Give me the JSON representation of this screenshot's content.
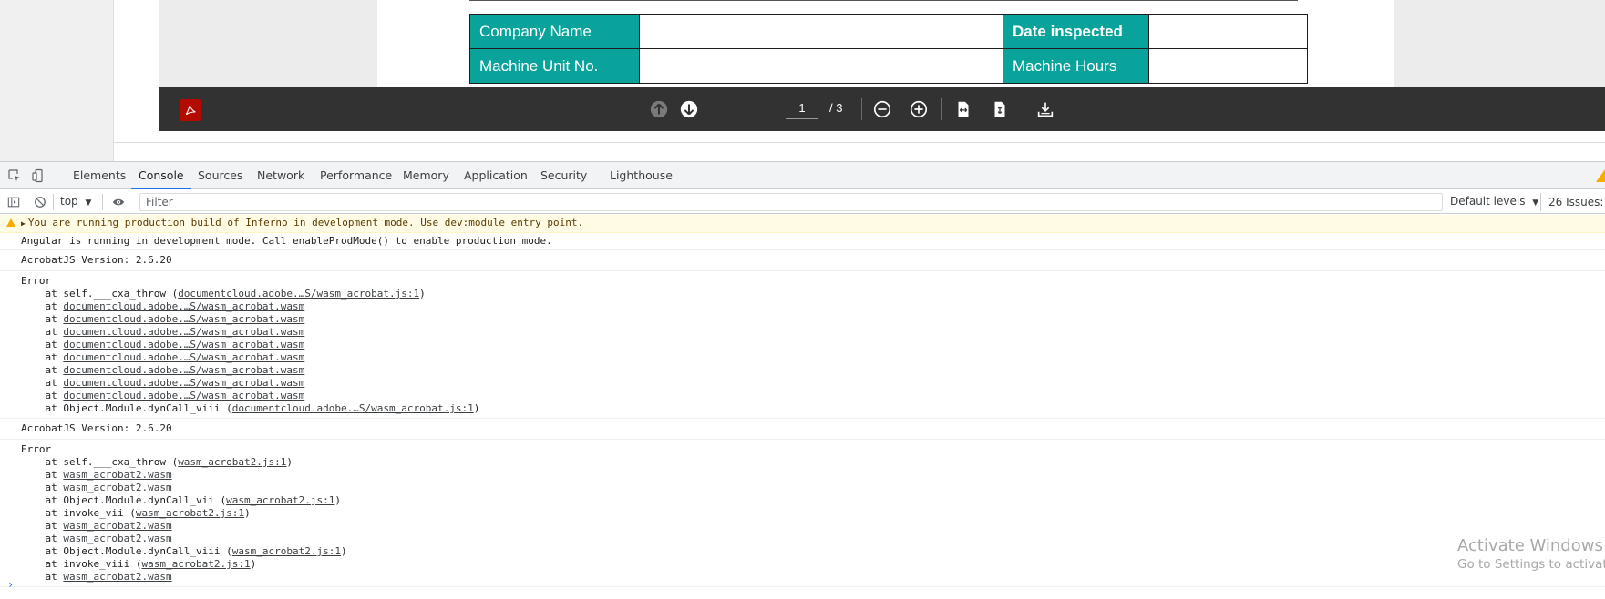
{
  "document": {
    "form_rows": [
      {
        "label_left": "Company Name",
        "label_right": "Date inspected"
      },
      {
        "label_left": "Machine Unit No.",
        "label_right": "Machine Hours"
      }
    ]
  },
  "pdf_toolbar": {
    "current_page": "1",
    "total_pages": "/ 3",
    "icons": [
      "acrobat-logo-icon",
      "previous-page-icon",
      "next-page-icon",
      "zoom-out-icon",
      "zoom-in-icon",
      "fit-width-icon",
      "fit-page-icon",
      "download-icon"
    ]
  },
  "devtools": {
    "tabs": [
      "Elements",
      "Console",
      "Sources",
      "Network",
      "Performance",
      "Memory",
      "Application",
      "Security",
      "Lighthouse"
    ],
    "active_tab": "Console",
    "context": "top",
    "filter_placeholder": "Filter",
    "levels": "Default levels",
    "issues": "26 Issues:"
  },
  "console": {
    "warning": "You are running production build of Inferno in development mode. Use dev:module entry point.",
    "angular": "Angular is running in development mode. Call enableProdMode() to enable production mode.",
    "acrobat_version_1": "AcrobatJS Version: 2.6.20",
    "error1_title": "Error",
    "error1_lines": [
      {
        "pre": "    at self.___cxa_throw (",
        "link": "documentcloud.adobe.…S/wasm_acrobat.js:1",
        "post": ")"
      },
      {
        "pre": "    at ",
        "link": "documentcloud.adobe.…S/wasm_acrobat.wasm",
        "post": ""
      },
      {
        "pre": "    at ",
        "link": "documentcloud.adobe.…S/wasm_acrobat.wasm",
        "post": ""
      },
      {
        "pre": "    at ",
        "link": "documentcloud.adobe.…S/wasm_acrobat.wasm",
        "post": ""
      },
      {
        "pre": "    at ",
        "link": "documentcloud.adobe.…S/wasm_acrobat.wasm",
        "post": ""
      },
      {
        "pre": "    at ",
        "link": "documentcloud.adobe.…S/wasm_acrobat.wasm",
        "post": ""
      },
      {
        "pre": "    at ",
        "link": "documentcloud.adobe.…S/wasm_acrobat.wasm",
        "post": ""
      },
      {
        "pre": "    at ",
        "link": "documentcloud.adobe.…S/wasm_acrobat.wasm",
        "post": ""
      },
      {
        "pre": "    at ",
        "link": "documentcloud.adobe.…S/wasm_acrobat.wasm",
        "post": ""
      },
      {
        "pre": "    at Object.Module.dynCall_viii (",
        "link": "documentcloud.adobe.…S/wasm_acrobat.js:1",
        "post": ")"
      }
    ],
    "acrobat_version_2": "AcrobatJS Version: 2.6.20",
    "error2_title": "Error",
    "error2_lines": [
      {
        "pre": "    at self.___cxa_throw (",
        "link": "wasm_acrobat2.js:1",
        "post": ")"
      },
      {
        "pre": "    at ",
        "link": "wasm_acrobat2.wasm",
        "post": ""
      },
      {
        "pre": "    at ",
        "link": "wasm_acrobat2.wasm",
        "post": ""
      },
      {
        "pre": "    at Object.Module.dynCall_vii (",
        "link": "wasm_acrobat2.js:1",
        "post": ")"
      },
      {
        "pre": "    at invoke_vii (",
        "link": "wasm_acrobat2.js:1",
        "post": ")"
      },
      {
        "pre": "    at ",
        "link": "wasm_acrobat2.wasm",
        "post": ""
      },
      {
        "pre": "    at ",
        "link": "wasm_acrobat2.wasm",
        "post": ""
      },
      {
        "pre": "    at Object.Module.dynCall_viii (",
        "link": "wasm_acrobat2.js:1",
        "post": ")"
      },
      {
        "pre": "    at invoke_viii (",
        "link": "wasm_acrobat2.js:1",
        "post": ")"
      },
      {
        "pre": "    at ",
        "link": "wasm_acrobat2.wasm",
        "post": ""
      }
    ],
    "prompt": "›"
  },
  "watermark": {
    "line1": "Activate Windows",
    "line2": "Go to Settings to activate Windows."
  },
  "colors": {
    "form_label_bg": "#0aa39b",
    "pdf_toolbar_bg": "#323232",
    "acrobat_red": "#b30b00",
    "devtools_accent": "#1a73e8",
    "warning_bg": "#fffbe5"
  }
}
